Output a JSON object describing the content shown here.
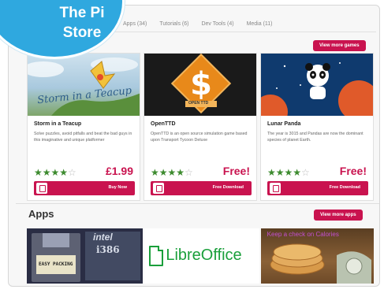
{
  "badge": {
    "line1": "The Pi",
    "line2": "Store"
  },
  "tabs": [
    "Apps (34)",
    "Tutorials (6)",
    "Dev Tools (4)",
    "Media (11)"
  ],
  "games_section": {
    "view_more_label": "View more games"
  },
  "cards": [
    {
      "title": "Storm in a Teacup",
      "description": "Solve puzzles, avoid pitfalls and beat the bad guys in this imaginative and unique platformer",
      "rating": 4,
      "price": "£1.99",
      "action_label": "Buy Now",
      "thumb_caption": "Storm in a Teacup"
    },
    {
      "title": "OpenTTD",
      "description": "OpenTTD is an open source simulation game based upon Transport Tycoon Deluxe",
      "rating": 4,
      "price": "Free!",
      "action_label": "Free Download",
      "thumb_caption": "OPEN TTD"
    },
    {
      "title": "Lunar Panda",
      "description": "The year is 3015 and Pandas are now the dominant species of planet Earth.",
      "rating": 4,
      "price": "Free!",
      "action_label": "Free Download"
    }
  ],
  "apps_section": {
    "title": "Apps",
    "view_more_label": "View more apps"
  },
  "apps": [
    {
      "name": "floppy-intel-tile",
      "label1": "intel",
      "label2": "i386",
      "label3": "EASY PACKING"
    },
    {
      "name": "libreoffice-tile",
      "label": "LibreOffice"
    },
    {
      "name": "cookie-tile",
      "label": "Keep a check on Calories"
    }
  ],
  "colors": {
    "accent": "#c9134f",
    "badge": "#2fa8df",
    "star": "#3d8b2f"
  },
  "icons": {
    "action": "document-icon",
    "star": "star-icon"
  }
}
